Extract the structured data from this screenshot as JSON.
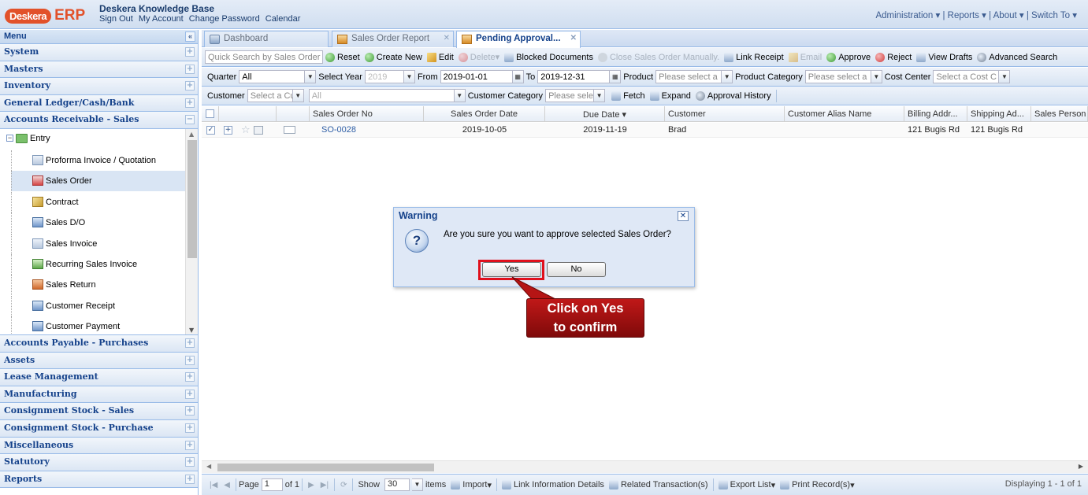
{
  "header": {
    "logo_badge": "Deskera",
    "logo_erp": "ERP",
    "title": "Deskera Knowledge Base",
    "links": [
      "Sign Out",
      "My Account",
      "Change Password",
      "Calendar"
    ],
    "right_menu": "Administration ▾ | Reports ▾ | About ▾ | Switch To ▾"
  },
  "menu": {
    "title": "Menu",
    "sections_top": [
      "System",
      "Masters",
      "Inventory",
      "General Ledger/Cash/Bank",
      "Accounts Receivable - Sales"
    ],
    "entry_label": "Entry",
    "tree_items": [
      {
        "label": "Proforma Invoice / Quotation",
        "icon": "document-icon"
      },
      {
        "label": "Sales Order",
        "icon": "sales-order-icon",
        "selected": true
      },
      {
        "label": "Contract",
        "icon": "pencil-icon"
      },
      {
        "label": "Sales D/O",
        "icon": "delivery-icon"
      },
      {
        "label": "Sales Invoice",
        "icon": "invoice-icon"
      },
      {
        "label": "Recurring Sales Invoice",
        "icon": "recurring-icon"
      },
      {
        "label": "Sales Return",
        "icon": "return-icon"
      },
      {
        "label": "Customer Receipt",
        "icon": "receipt-icon"
      },
      {
        "label": "Customer Payment",
        "icon": "payment-icon"
      }
    ],
    "sections_bottom": [
      "Accounts Payable - Purchases",
      "Assets",
      "Lease Management",
      "Manufacturing",
      "Consignment Stock - Sales",
      "Consignment Stock - Purchase",
      "Miscellaneous",
      "Statutory",
      "Reports"
    ]
  },
  "tabs": [
    {
      "label": "Dashboard",
      "active": false
    },
    {
      "label": "Sales Order Report",
      "active": false
    },
    {
      "label": "Pending Approval...",
      "active": true
    }
  ],
  "toolbar1": {
    "search_placeholder": "Quick Search by Sales Order",
    "reset": "Reset",
    "create_new": "Create New",
    "edit": "Edit",
    "delete": "Delete",
    "blocked_documents": "Blocked Documents",
    "close_manually": "Close Sales Order Manually.",
    "link_receipt": "Link Receipt",
    "email": "Email",
    "approve": "Approve",
    "reject": "Reject",
    "view_drafts": "View Drafts",
    "advanced_search": "Advanced Search"
  },
  "toolbar2": {
    "quarter_label": "Quarter",
    "quarter_value": "All",
    "year_label": "Select Year",
    "year_value": "2019",
    "from_label": "From",
    "from_value": "2019-01-01",
    "to_label": "To",
    "to_value": "2019-12-31",
    "product_label": "Product",
    "product_placeholder": "Please select a",
    "product_category_label": "Product Category",
    "product_category_placeholder": "Please select a",
    "cost_center_label": "Cost Center",
    "cost_center_placeholder": "Select a Cost C"
  },
  "toolbar3": {
    "customer_label": "Customer",
    "customer_placeholder": "Select a Cu",
    "all_value": "All",
    "customer_category_label": "Customer Category",
    "customer_category_placeholder": "Please sele",
    "fetch": "Fetch",
    "expand": "Expand",
    "approval_history": "Approval History"
  },
  "grid": {
    "columns": [
      "Sales Order No",
      "Sales Order Date",
      "Due Date ▾",
      "Customer",
      "Customer Alias Name",
      "Billing Addr...",
      "Shipping Ad...",
      "Sales Person"
    ],
    "rows": [
      {
        "order_no": "SO-0028",
        "order_date": "2019-10-05",
        "due_date": "2019-11-19",
        "customer": "Brad",
        "alias": "",
        "billing": "121 Bugis Rd",
        "shipping": "121 Bugis Rd",
        "sales_person": ""
      }
    ]
  },
  "pager": {
    "page_label": "Page",
    "page_value": "1",
    "of_label": "of 1",
    "show_label": "Show",
    "show_value": "30",
    "items_label": "items",
    "import": "Import",
    "link_info": "Link Information Details",
    "related": "Related Transaction(s)",
    "export": "Export List",
    "print": "Print Record(s)",
    "displaying": "Displaying 1 - 1 of 1"
  },
  "dialog": {
    "title": "Warning",
    "message": "Are you sure you want to approve selected Sales Order?",
    "yes": "Yes",
    "no": "No"
  },
  "callout": {
    "line1": "Click on Yes",
    "line2": "to confirm"
  }
}
